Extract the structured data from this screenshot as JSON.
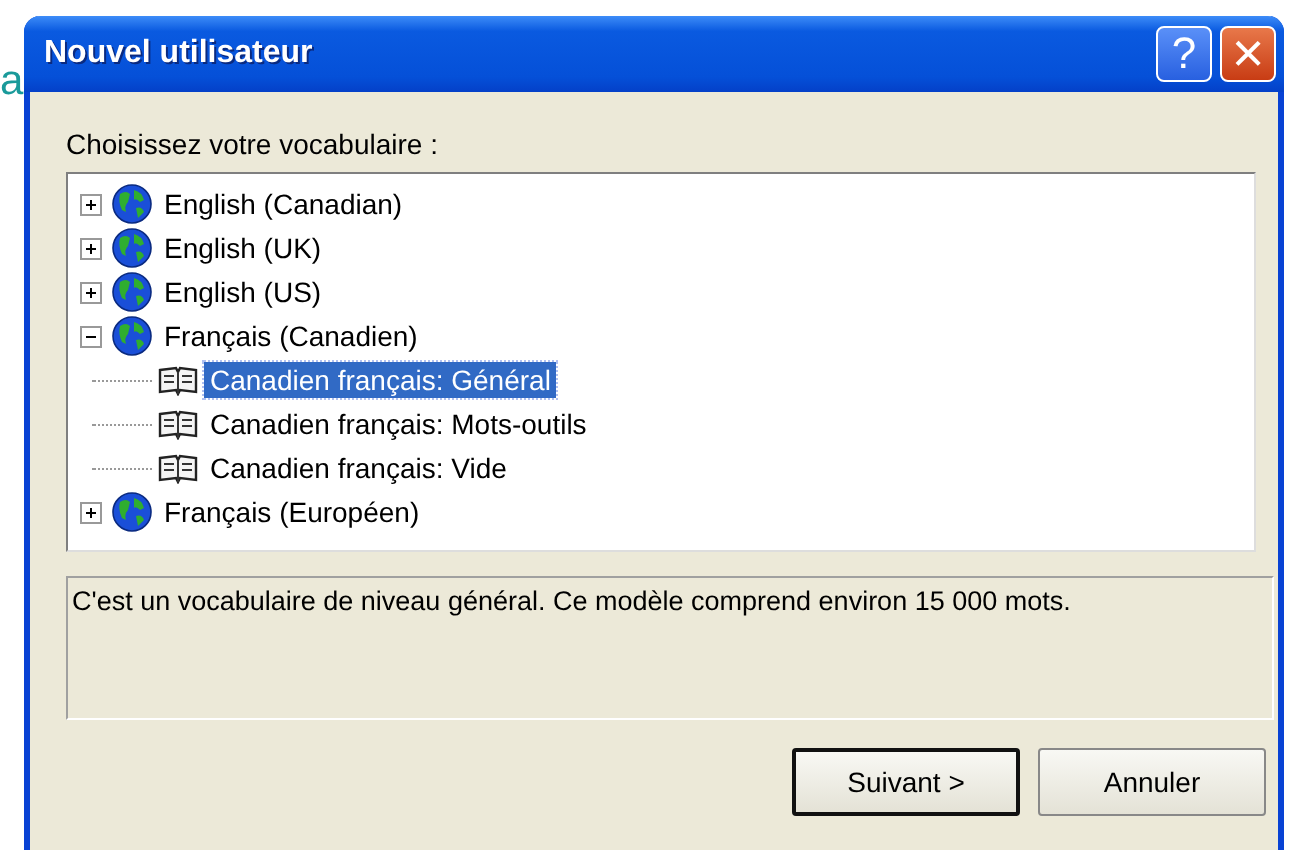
{
  "background_text": "a",
  "window": {
    "title": "Nouvel utilisateur",
    "help_button": "?",
    "close_button": "×"
  },
  "prompt": "Choisissez votre vocabulaire :",
  "tree": [
    {
      "label": "English (Canadian)",
      "kind": "language",
      "expanded": false,
      "selected": false
    },
    {
      "label": "English (UK)",
      "kind": "language",
      "expanded": false,
      "selected": false
    },
    {
      "label": "English (US)",
      "kind": "language",
      "expanded": false,
      "selected": false
    },
    {
      "label": "Français (Canadien)",
      "kind": "language",
      "expanded": true,
      "selected": false,
      "children": [
        {
          "label": "Canadien français: Général",
          "kind": "vocabulary",
          "selected": true
        },
        {
          "label": "Canadien français: Mots-outils",
          "kind": "vocabulary",
          "selected": false
        },
        {
          "label": "Canadien français: Vide",
          "kind": "vocabulary",
          "selected": false
        }
      ]
    },
    {
      "label": "Français (Européen)",
      "kind": "language",
      "expanded": false,
      "selected": false
    }
  ],
  "description": "C'est un vocabulaire de niveau général. Ce modèle comprend environ 15 000 mots.",
  "buttons": [
    {
      "label": "Suivant >",
      "default": true
    },
    {
      "label": "Annuler",
      "default": false
    }
  ]
}
